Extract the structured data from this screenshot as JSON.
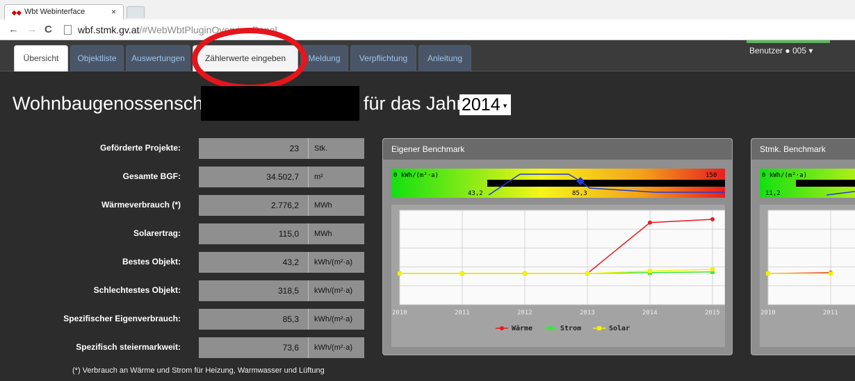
{
  "browser": {
    "tab_title": "Wbt Webinterface",
    "tab_close": "×",
    "url_host": "wbf.stmk.gv.at",
    "url_path": "/#WebWbtPluginOverviewPanel"
  },
  "nav": {
    "tabs": [
      {
        "label": "Übersicht"
      },
      {
        "label": "Objektliste"
      },
      {
        "label": "Auswertungen"
      },
      {
        "label": "Zählerwerte eingeben"
      },
      {
        "label": "Meldung"
      },
      {
        "label": "Verpflichtung"
      },
      {
        "label": "Anleitung"
      }
    ],
    "user_label": "Benutzer",
    "user_id": "005"
  },
  "header": {
    "title_prefix": "Wohnbaugenossenscha",
    "title_suffix": "für das Jahr",
    "year": "2014"
  },
  "stats": [
    {
      "label": "Geförderte Projekte:",
      "value": "23",
      "unit": "Stk."
    },
    {
      "label": "Gesamte BGF:",
      "value": "34.502,7",
      "unit": "m²"
    },
    {
      "label": "Wärmeverbrauch (*)",
      "value": "2.776,2",
      "unit": "MWh"
    },
    {
      "label": "Solarertrag:",
      "value": "115,0",
      "unit": "MWh"
    },
    {
      "label": "Bestes Objekt:",
      "value": "43,2",
      "unit": "kWh/(m²·a)"
    },
    {
      "label": "Schlechtestes Objekt:",
      "value": "318,5",
      "unit": "kWh/(m²·a)"
    },
    {
      "label": "Spezifischer Eigenverbrauch:",
      "value": "85,3",
      "unit": "kWh/(m²·a)"
    },
    {
      "label": "Spezifisch steiermarkweit:",
      "value": "73,6",
      "unit": "kWh/(m²·a)"
    }
  ],
  "footnote": "(*) Verbrauch an Wärme und Strom für Heizung, Warmwasser und Lüftung",
  "panels": {
    "eigener": {
      "title": "Eigener Benchmark",
      "scale_min_label": "0 kWh/(m²·a)",
      "scale_max_label": "150",
      "best_label": "43,2",
      "own_label": "85,3"
    },
    "stmk": {
      "title": "Stmk. Benchmark",
      "scale_min_label": "0 kWh/(m²·a)",
      "best_label": "11,2"
    }
  },
  "chart_data": [
    {
      "type": "line",
      "title": "Eigener Benchmark",
      "x": [
        2010,
        2011,
        2012,
        2013,
        2014,
        2015
      ],
      "ylim": [
        0,
        1
      ],
      "series": [
        {
          "name": "Wärme",
          "color": "#e8191e",
          "values": [
            0.0,
            0.0,
            0.0,
            0.0,
            0.62,
            0.66
          ]
        },
        {
          "name": "Strom",
          "color": "#3ce63c",
          "values": [
            0.0,
            0.0,
            0.0,
            0.0,
            0.01,
            0.02
          ]
        },
        {
          "name": "Solar",
          "color": "#f2f20a",
          "values": [
            0.0,
            0.0,
            0.0,
            0.0,
            0.03,
            0.05
          ]
        }
      ],
      "grid": true,
      "legend": "bottom"
    },
    {
      "type": "line",
      "title": "Stmk. Benchmark",
      "x": [
        2010,
        2011
      ],
      "ylim": [
        0,
        1
      ],
      "series": [
        {
          "name": "Wärme",
          "color": "#e8191e",
          "values": [
            0.0,
            0.01
          ]
        },
        {
          "name": "Solar",
          "color": "#f2f20a",
          "values": [
            0.0,
            0.0
          ]
        }
      ],
      "grid": true
    }
  ]
}
